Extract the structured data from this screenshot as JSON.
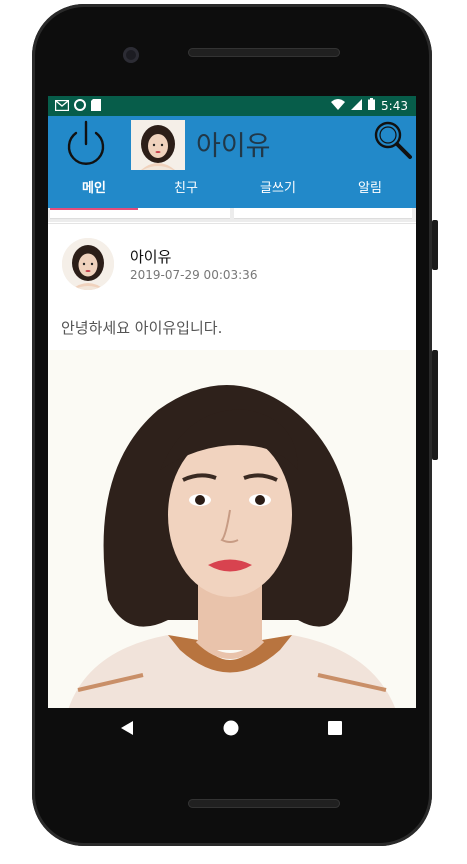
{
  "status_bar": {
    "time": "5:43",
    "left_icons": [
      "gmail-icon",
      "sync-icon",
      "sd-card-icon"
    ],
    "right_icons": [
      "wifi-icon",
      "signal-icon",
      "battery-icon"
    ]
  },
  "app_bar": {
    "title": "아이유",
    "left_icon": "power-icon",
    "right_icon": "search-icon",
    "color": "#2289c9"
  },
  "tabs": [
    {
      "label": "메인",
      "active": true
    },
    {
      "label": "친구",
      "active": false
    },
    {
      "label": "글쓰기",
      "active": false
    },
    {
      "label": "알림",
      "active": false
    }
  ],
  "post": {
    "author": "아이유",
    "timestamp": "2019-07-29 00:03:36",
    "text": "안녕하세요 아이유입니다."
  },
  "nav_bar": [
    "back-icon",
    "home-icon",
    "recents-icon"
  ]
}
